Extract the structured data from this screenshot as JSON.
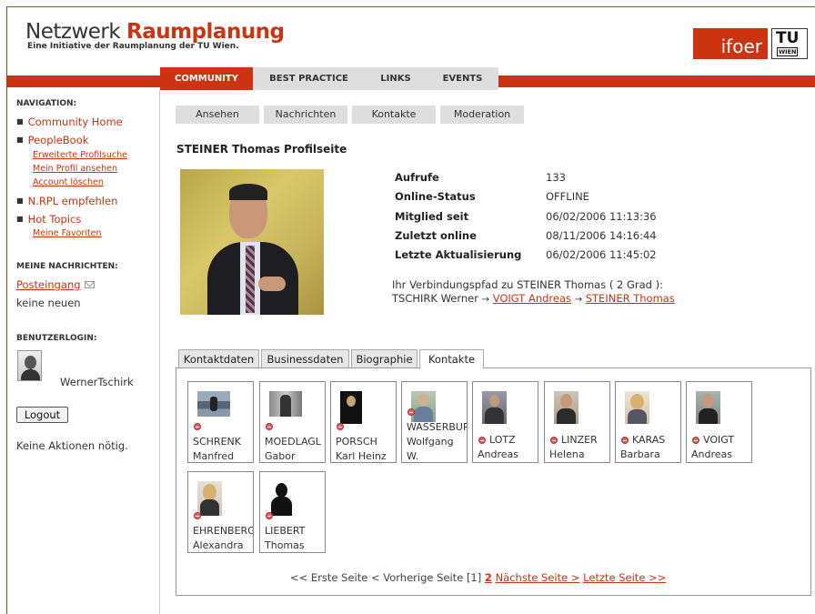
{
  "header": {
    "logo_word1": "Netzwerk",
    "logo_word2": "Raumplanung",
    "logo_sub": "Eine Initiative der Raumplanung der TU Wien.",
    "partner_logo": "ifoer",
    "tu_logo_top": "TU",
    "tu_logo_bottom": "WIEN"
  },
  "nav_tabs": [
    {
      "label": "COMMUNITY",
      "active": true
    },
    {
      "label": "BEST PRACTICE",
      "active": false
    },
    {
      "label": "LINKS",
      "active": false
    },
    {
      "label": "EVENTS",
      "active": false
    }
  ],
  "sidebar": {
    "nav_heading": "NAVIGATION:",
    "items": [
      {
        "label": "Community Home"
      },
      {
        "label": "PeopleBook"
      },
      {
        "label": "N.RPL empfehlen"
      },
      {
        "label": "Hot Topics"
      }
    ],
    "peoplebook_sub": [
      "Erweiterte Profilsuche",
      "Mein Profil ansehen",
      "Account löschen"
    ],
    "hottopics_sub": [
      "Meine Favoriten"
    ],
    "messages_heading": "MEINE NACHRICHTEN:",
    "inbox_label": "Posteingang",
    "inbox_status": "keine neuen",
    "login_heading": "BENUTZERLOGIN:",
    "username": "WernerTschirk",
    "logout_label": "Logout",
    "actions_text": "Keine Aktionen nötig."
  },
  "subtabs": [
    "Ansehen",
    "Nachrichten",
    "Kontakte",
    "Moderation"
  ],
  "profile": {
    "title": "STEINER Thomas Profilseite",
    "stats": [
      {
        "label": "Aufrufe",
        "value": "133"
      },
      {
        "label": "Online-Status",
        "value": "OFFLINE"
      },
      {
        "label": "Mitglied seit",
        "value": "06/02/2006 11:13:36"
      },
      {
        "label": "Zuletzt online",
        "value": "08/11/2006 14:16:44"
      },
      {
        "label": "Letzte Aktualisierung",
        "value": "06/02/2006 11:45:02"
      }
    ],
    "path_intro": "Ihr Verbindungspfad zu STEINER Thomas ( 2 Grad ):",
    "path_start": "TSCHIRK Werner",
    "path_link1": "VOIGT Andreas",
    "path_link2": "STEINER Thomas",
    "arrow": "→"
  },
  "profile_tabs": [
    {
      "label": "Kontaktdaten",
      "active": false
    },
    {
      "label": "Businessdaten",
      "active": false
    },
    {
      "label": "Biographie",
      "active": false
    },
    {
      "label": "Kontakte",
      "active": true
    }
  ],
  "contacts": [
    {
      "last": "SCHRENK",
      "first": "Manfred"
    },
    {
      "last": "MOEDLAGL",
      "first": "Gabor"
    },
    {
      "last": "PORSCH",
      "first": "Karl Heinz"
    },
    {
      "last": "WASSERBUR",
      "first": "Wolfgang",
      "extra": "W."
    },
    {
      "last": "LOTZ",
      "first": "Andreas"
    },
    {
      "last": "LINZER",
      "first": "Helena"
    },
    {
      "last": "KARAS",
      "first": "Barbara"
    },
    {
      "last": "VOIGT",
      "first": "Andreas"
    },
    {
      "last": "EHRENBERGE",
      "first": "Alexandra"
    },
    {
      "last": "LIEBERT",
      "first": "Thomas"
    }
  ],
  "pager": {
    "first": "<< Erste Seite",
    "prev": "< Vorherige Seite",
    "page1": "[1]",
    "current": "2",
    "next": "Nächste Seite >",
    "last": "Letzte Seite >>"
  },
  "colors": {
    "accent": "#cc3311",
    "tab_bg": "#dedede",
    "status_dot": "#e86060"
  }
}
